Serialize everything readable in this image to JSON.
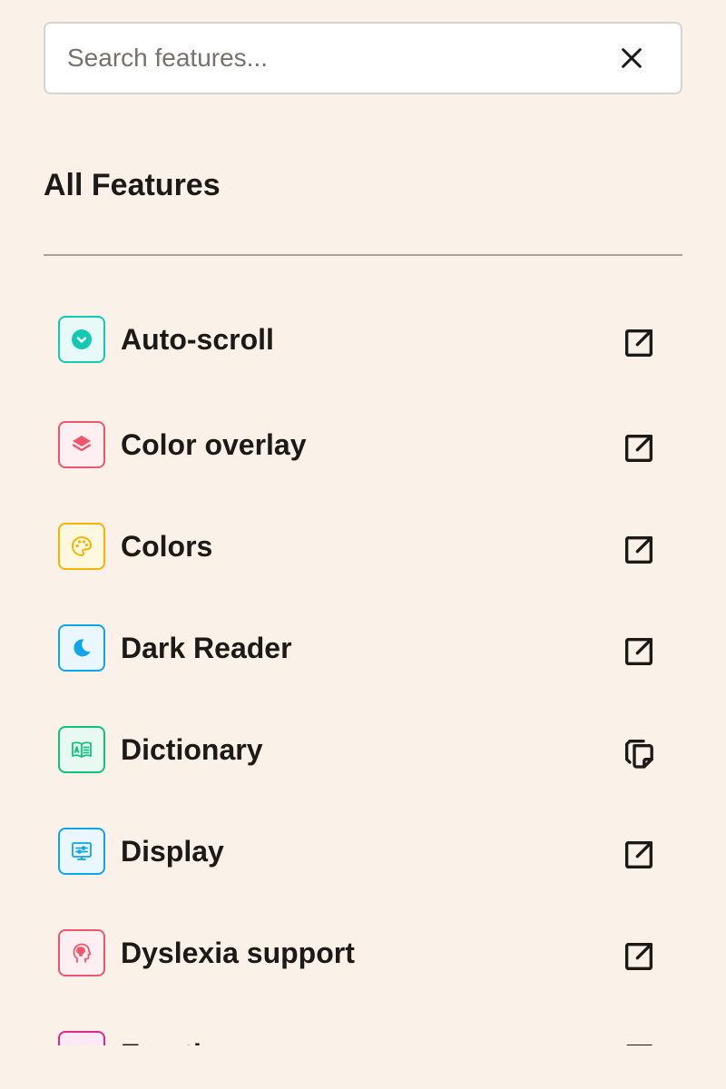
{
  "search": {
    "placeholder": "Search features...",
    "value": ""
  },
  "section": {
    "title": "All Features"
  },
  "features": [
    {
      "label": "Auto-scroll",
      "icon": "chevron-circle-icon",
      "color": "#14C9B4",
      "bg": "#E8FAF7",
      "action": "open-external-icon"
    },
    {
      "label": "Color overlay",
      "icon": "layers-icon",
      "color": "#F0566B",
      "bg": "#FEF0F2",
      "action": "open-external-icon"
    },
    {
      "label": "Colors",
      "icon": "palette-icon",
      "color": "#F5B400",
      "bg": "#FFF8E1",
      "action": "open-external-icon"
    },
    {
      "label": "Dark Reader",
      "icon": "moon-icon",
      "color": "#0EA5E9",
      "bg": "#EAF7FE",
      "action": "open-external-icon"
    },
    {
      "label": "Dictionary",
      "icon": "book-icon",
      "color": "#10C27C",
      "bg": "#E8F9F1",
      "action": "copy-icon"
    },
    {
      "label": "Display",
      "icon": "monitor-icon",
      "color": "#0EA5E9",
      "bg": "#EAF7FE",
      "action": "open-external-icon"
    },
    {
      "label": "Dyslexia support",
      "icon": "head-icon",
      "color": "#F0566B",
      "bg": "#FEF0F2",
      "action": "open-external-icon"
    },
    {
      "label": "Emotion",
      "icon": "text-icon",
      "color": "#E0288A",
      "bg": "#FCE9F3",
      "action": "open-external-icon"
    }
  ]
}
